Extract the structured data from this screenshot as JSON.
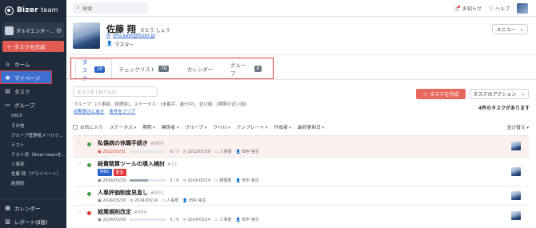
{
  "sidebar": {
    "logo": "Bizer",
    "logo_suffix": "team",
    "org_name": "ダルマエンター...",
    "create_task": "タスクを作成",
    "nav": [
      {
        "label": "ホーム",
        "icon": "home-icon"
      },
      {
        "label": "マイページ",
        "icon": "mypage-icon"
      },
      {
        "label": "タスク",
        "icon": "task-icon"
      },
      {
        "label": "グループ",
        "icon": "group-icon"
      }
    ],
    "groups": [
      "0815",
      "その他",
      "グループ管理者メールテ...",
      "テスト",
      "テスト用（Bizer teamを...",
      "人事部",
      "佐藤 翔（プライベート）",
      "経理部"
    ],
    "bottom": [
      {
        "label": "カレンダー",
        "icon": "calendar-icon"
      },
      {
        "label": "レポート(β版)",
        "icon": "report-icon"
      }
    ]
  },
  "topbar": {
    "search_placeholder": "検索",
    "notifications": "お知らせ",
    "help": "ヘルプ"
  },
  "profile": {
    "name": "佐藤 翔",
    "kana": "さとう しょう",
    "email": "sho.sato@bizer.jp",
    "role": "マスター",
    "menu": "メニュー"
  },
  "tabs": [
    {
      "label": "タスク",
      "count": "28"
    },
    {
      "label": "チェックリスト",
      "count": "76"
    },
    {
      "label": "カレンダー",
      "count": ""
    },
    {
      "label": "グループ",
      "count": "8"
    }
  ],
  "filter": {
    "placeholder": "タスク名で絞り込む",
    "conditions": "グループ：[人事部、経理部]、ステータス：[未着手、進行中]、並び順：[期限の近い順]",
    "reset": "初期表示に戻す",
    "clear": "条件をクリア"
  },
  "actions": {
    "create_task": "タスクを作成",
    "task_action": "タスクのアクション",
    "count": "4件のタスクがあります"
  },
  "columns": [
    "お気に入り",
    "ステータス",
    "期限",
    "関係者",
    "グループ",
    "ラベル",
    "テンプレート",
    "作成者",
    "最終更新日"
  ],
  "sort": "並び替え",
  "tasks": [
    {
      "title": "私傷病の休職手続き",
      "id": "#900",
      "progress_label": "0 / 7",
      "progress": 0,
      "due": "2022/10/31",
      "created": "2022/07/19",
      "group": "人事部",
      "owner": "田中 裕生",
      "status_color": "#43a047",
      "highlight": true,
      "tags": []
    },
    {
      "title": "経費精算ツールの導入検討",
      "id": "#11",
      "progress_label": "3 / 6",
      "progress": 0.5,
      "due": "2024/03/29",
      "created": "2024/03/14",
      "group": "経理部",
      "owner": "田中 裕生",
      "status_color": "#43a047",
      "highlight": false,
      "tags": [
        {
          "label": "MBO",
          "color": "#2a62c9"
        },
        {
          "label": "緊急",
          "color": "#e0393b"
        }
      ]
    },
    {
      "title": "人事評価制度見直し",
      "id": "#901",
      "progress_label": "",
      "progress": null,
      "due": "2024/03/29",
      "created": "2024/03/14",
      "group": "人事部",
      "owner": "田中 裕生",
      "status_color": "#43a047",
      "highlight": false,
      "tags": []
    },
    {
      "title": "就業規則改定",
      "id": "#904",
      "progress_label": "0 / 6",
      "progress": 0,
      "due": "2024/03/29",
      "created": "2024/03/14",
      "group": "人事部",
      "owner": "田中 裕生",
      "status_color": "#e0393b",
      "highlight": false,
      "tags": []
    }
  ]
}
